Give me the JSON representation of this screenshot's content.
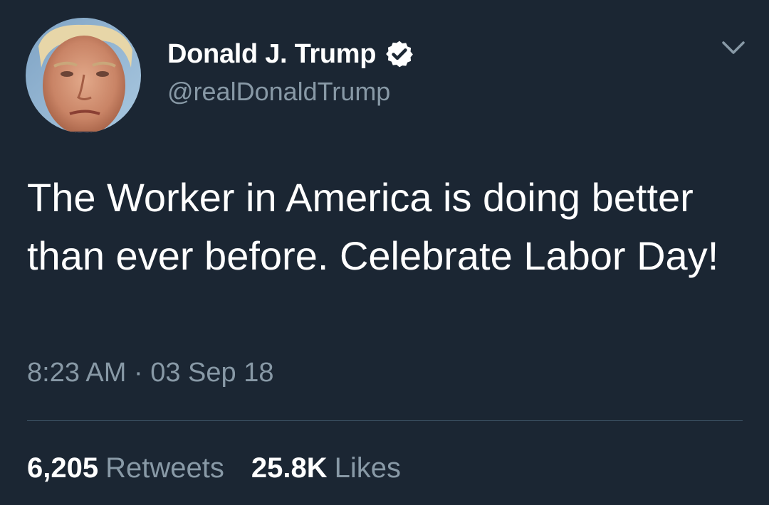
{
  "tweet": {
    "author": {
      "display_name": "Donald J. Trump",
      "handle": "@realDonaldTrump",
      "verified": true,
      "avatar_icon": "profile-photo",
      "verified_icon": "verified-badge-icon"
    },
    "menu_icon": "chevron-down-icon",
    "text": "The Worker in America is doing better than ever before. Celebrate Labor Day!",
    "time": "8:23 AM",
    "separator": " · ",
    "date": "03 Sep 18",
    "retweets": {
      "count": "6,205",
      "label": "Retweets"
    },
    "likes": {
      "count": "25.8K",
      "label": "Likes"
    }
  },
  "colors": {
    "background": "#1b2633",
    "primary_text": "#ffffff",
    "secondary_text": "#8899a6",
    "divider": "#3d5466"
  }
}
